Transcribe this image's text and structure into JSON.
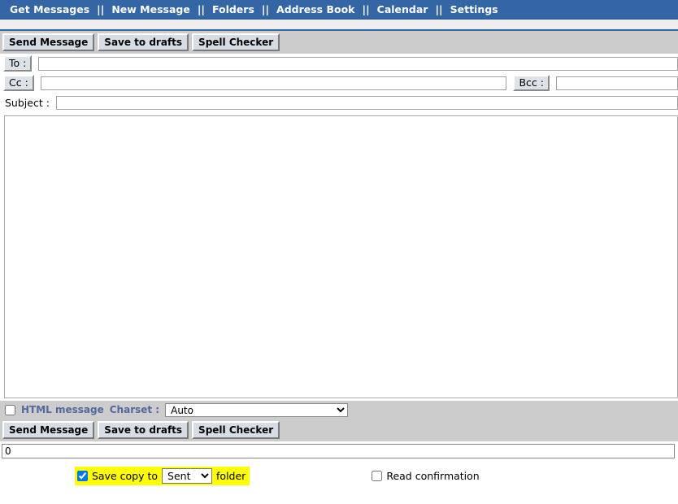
{
  "nav": {
    "separator": "||",
    "items": [
      {
        "label": "Get Messages"
      },
      {
        "label": "New Message"
      },
      {
        "label": "Folders"
      },
      {
        "label": "Address Book"
      },
      {
        "label": "Calendar"
      },
      {
        "label": "Settings"
      }
    ]
  },
  "toolbar": {
    "send_label": "Send Message",
    "drafts_label": "Save to drafts",
    "spell_label": "Spell Checker"
  },
  "compose": {
    "to_label": "To :",
    "to_value": "",
    "cc_label": "Cc :",
    "cc_value": "",
    "bcc_label": "Bcc :",
    "bcc_value": "",
    "subject_label": "Subject :",
    "subject_value": "",
    "body_value": ""
  },
  "options": {
    "html_message_label": "HTML message",
    "html_message_checked": false,
    "charset_label": "Charset :",
    "charset_value": "Auto",
    "charset_options": [
      "Auto"
    ]
  },
  "attachment": {
    "value": "",
    "icon": "paperclip-icon"
  },
  "footer": {
    "save_copy_checked": true,
    "save_copy_prefix": "Save copy to",
    "save_copy_folder": "Sent",
    "folder_options": [
      "Sent"
    ],
    "save_copy_suffix": "folder",
    "read_confirmation_label": "Read confirmation",
    "read_confirmation_checked": false
  },
  "colors": {
    "nav_blue": "#3465a4",
    "toolbar_gray": "#cccccc",
    "label_blue": "#53689c",
    "highlight_yellow": "#ffff00"
  }
}
